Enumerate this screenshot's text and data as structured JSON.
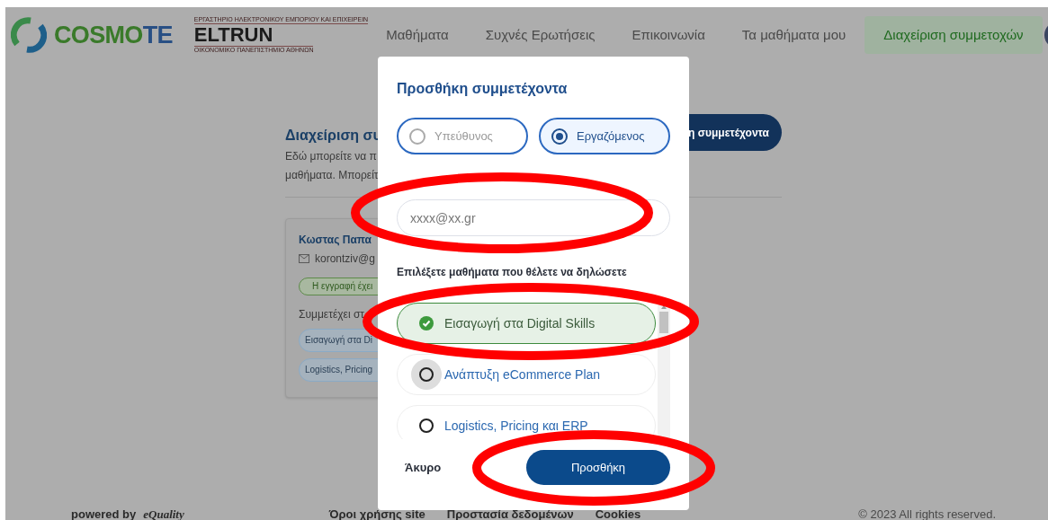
{
  "header": {
    "brand": {
      "cosmote_a": "COSMO",
      "cosmote_b": "TE",
      "eltrun_top": "ΕΡΓΑΣΤΗΡΙΟ ΗΛΕΚΤΡΟΝΙΚΟΥ ΕΜΠΟΡΙΟΥ ΚΑΙ ΕΠΙΧΕΙΡΕΙΝ",
      "eltrun": "ELTRUN",
      "eltrun_bottom": "ΟΙΚΟΝΟΜΙΚΟ ΠΑΝΕΠΙΣΤΗΜΙΟ ΑΘΗΝΩΝ"
    },
    "nav": [
      {
        "label": "Μαθήματα",
        "selected": false
      },
      {
        "label": "Συχνές Ερωτήσεις",
        "selected": false
      },
      {
        "label": "Επικοινωνία",
        "selected": false
      },
      {
        "label": "Τα μαθήματα μου",
        "selected": false
      },
      {
        "label": "Διαχείριση συμμετοχών",
        "selected": true
      }
    ]
  },
  "page": {
    "title": "Διαχείριση συ",
    "description": [
      "Εδώ μπορείτε να π",
      "μαθήματα. Μπορείτ"
    ],
    "add_button": "η συμμετέχοντα",
    "participant": {
      "name": "Κωστας Παπα",
      "email": "korontziv@g",
      "status": "Η εγγραφή έχει",
      "courses_label": "Συμμετέχει στ",
      "courses": [
        "Εισαγωγή στα Di",
        "Logistics, Pricing"
      ]
    }
  },
  "modal": {
    "title": "Προσθήκη συμμετέχοντα",
    "roles": [
      {
        "label": "Υπεύθυνος",
        "selected": false
      },
      {
        "label": "Εργαζόμενος",
        "selected": true
      }
    ],
    "email": {
      "placeholder": "xxxx@xx.gr"
    },
    "courses_label": "Επιλέξετε μαθήματα που θέλετε να δηλώσετε",
    "courses": [
      {
        "label": "Εισαγωγή στα Digital Skills",
        "selected": true,
        "hovered": false
      },
      {
        "label": "Ανάπτυξη eCommerce Plan",
        "selected": false,
        "hovered": true
      },
      {
        "label": "Logistics, Pricing και ERP",
        "selected": false,
        "hovered": false
      }
    ],
    "cancel": "Άκυρο",
    "submit": "Προσθήκη"
  },
  "footer": {
    "powered_by": "powered by",
    "logo": "eQuality",
    "links": [
      "Όροι χρήσης site",
      "Προστασία δεδομένων",
      "Cookies"
    ],
    "copyright": "© 2023 All rights reserved."
  }
}
